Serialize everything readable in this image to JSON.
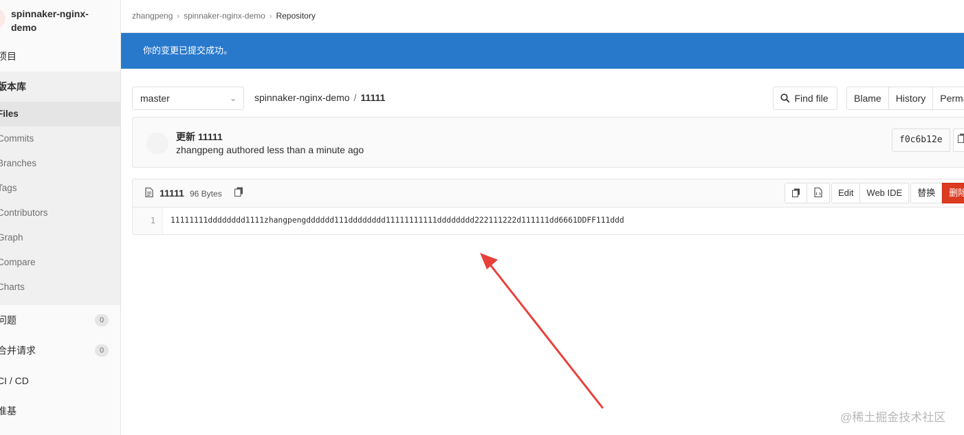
{
  "sidebar": {
    "project_name": "spinnaker-nginx-demo",
    "items": [
      {
        "label": "项目"
      },
      {
        "label": "版本库"
      },
      {
        "label": "Files"
      },
      {
        "label": "Commits"
      },
      {
        "label": "Branches"
      },
      {
        "label": "Tags"
      },
      {
        "label": "Contributors"
      },
      {
        "label": "Graph"
      },
      {
        "label": "Compare"
      },
      {
        "label": "Charts"
      },
      {
        "label": "问题",
        "count": "0"
      },
      {
        "label": "合并请求",
        "count": "0"
      },
      {
        "label": "CI / CD"
      },
      {
        "label": "准基"
      }
    ]
  },
  "breadcrumb": {
    "items": [
      "zhangpeng",
      "spinnaker-nginx-demo",
      "Repository"
    ],
    "separator": "›"
  },
  "flash": {
    "message": "你的变更已提交成功。",
    "color": "#2879cc"
  },
  "tree": {
    "branch": "master",
    "path_project": "spinnaker-nginx-demo",
    "path_sep": "/",
    "path_file": "11111",
    "find_file": "Find file",
    "buttons": [
      "Blame",
      "History",
      "Perma"
    ]
  },
  "commit": {
    "title": "更新 11111",
    "meta": "zhangpeng authored less than a minute ago",
    "sha": "f0c6b12e"
  },
  "file": {
    "name": "11111",
    "size": "96 Bytes",
    "actions": {
      "edit": "Edit",
      "web_ide": "Web IDE",
      "replace": "替换",
      "delete": "删除"
    },
    "line_number": "1",
    "content": "11111111dddddddd1111zhangpengdddddd111dddddddd11111111111dddddddd222111222d111111dd6661DDFF111ddd"
  },
  "annotation": {
    "arrow_color": "#e8403a"
  },
  "watermark": "@稀土掘金技术社区"
}
